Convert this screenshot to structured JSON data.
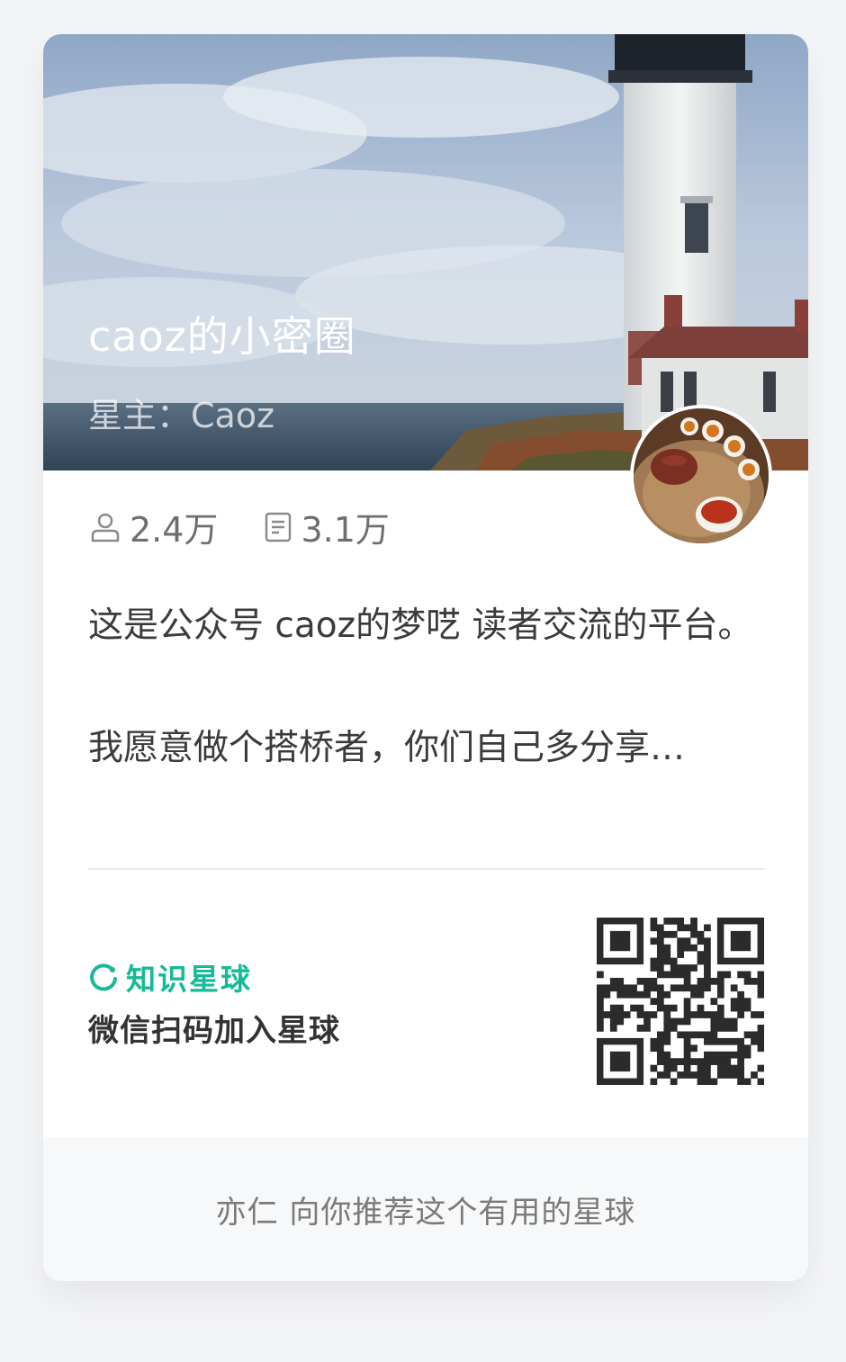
{
  "circle": {
    "title": "caoz的小密圈",
    "owner_line": "星主：Caoz"
  },
  "stats": {
    "members": "2.4万",
    "topics": "3.1万"
  },
  "description": {
    "paragraph1": "这是公众号 caoz的梦呓 读者交流的平台。",
    "paragraph2": "我愿意做个搭桥者，你们自己多分享…"
  },
  "brand": {
    "name": "知识星球",
    "color": "#16b998"
  },
  "scan_text": "微信扫码加入星球",
  "footer": {
    "recommend_text": "亦仁 向你推荐这个有用的星球"
  },
  "icons": {
    "members": "person-icon",
    "topics": "document-icon",
    "brand": "knowledge-planet-logo-icon"
  }
}
